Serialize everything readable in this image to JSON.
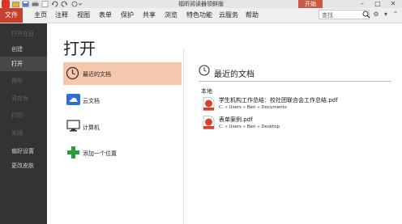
{
  "titlebar": {
    "title": "福昕阅读器领鲜版",
    "tab_label": "开始",
    "window_controls": [
      "minimize-icon",
      "maximize-icon",
      "close-icon"
    ]
  },
  "menubar": {
    "file_label": "文件",
    "items": [
      "主页",
      "注释",
      "视图",
      "表单",
      "保护",
      "共享",
      "浏览",
      "特色功能",
      "云服务",
      "帮助"
    ],
    "search_placeholder": "查找"
  },
  "sidebar": {
    "items": [
      {
        "label": "打开在目",
        "state": "dim"
      },
      {
        "label": "创建",
        "state": "normal"
      },
      {
        "label": "打开",
        "state": "active"
      },
      {
        "label": "保存",
        "state": "dim"
      },
      {
        "label": "另存为",
        "state": "dim"
      },
      {
        "label": "打印",
        "state": "dim"
      },
      {
        "label": "关闭",
        "state": "dim"
      },
      {
        "label": "偏好设置",
        "state": "normal"
      },
      {
        "label": "更改皮肤",
        "state": "normal"
      }
    ]
  },
  "main": {
    "heading": "打开",
    "locations": [
      {
        "label": "最近的文档",
        "icon": "clock-icon",
        "selected": true
      },
      {
        "label": "云文档",
        "icon": "cloud-icon",
        "selected": false
      },
      {
        "label": "计算机",
        "icon": "computer-icon",
        "selected": false
      },
      {
        "label": "添加一个位置",
        "icon": "plus-icon",
        "selected": false
      }
    ]
  },
  "recent": {
    "title": "最近的文档",
    "group": "本地",
    "files": [
      {
        "name": "学生机构工作总结：校社团联合会工作总结.pdf",
        "path": "C: » Users » Ben » Documents"
      },
      {
        "name": "表单案例.pdf",
        "path": "C: » Users » Ben » Desktop"
      }
    ]
  },
  "colors": {
    "accent": "#c8412f",
    "sidebar_bg": "#333333",
    "selected_bg": "#f7c7ad"
  }
}
